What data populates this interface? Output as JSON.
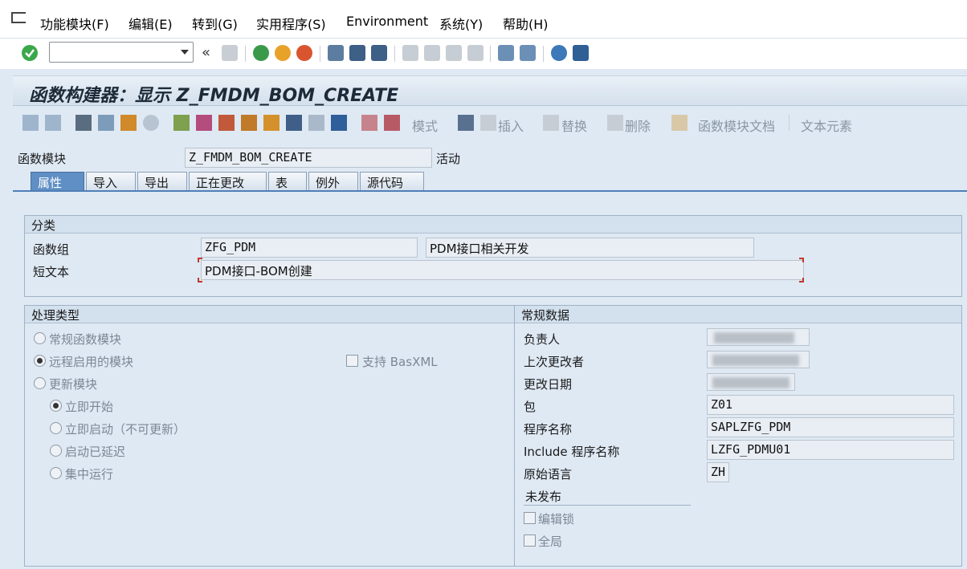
{
  "menu": {
    "items": [
      {
        "label": "功能模块(F)"
      },
      {
        "label": "编辑(E)"
      },
      {
        "label": "转到(G)"
      },
      {
        "label": "实用程序(S)"
      },
      {
        "label": "Environment"
      },
      {
        "label": "系统(Y)"
      },
      {
        "label": "帮助(H)"
      }
    ]
  },
  "toolbar": {
    "command_value": "",
    "back_chevrons": "«"
  },
  "title": "函数构建器：显示 Z_FMDM_BOM_CREATE",
  "app_toolbar": {
    "mode_label": "模式",
    "insert_label": "插入",
    "replace_label": "替换",
    "delete_label": "删除",
    "fm_doc_label": "函数模块文档",
    "text_elements_label": "文本元素"
  },
  "header": {
    "fm_label": "函数模块",
    "fm_value": "Z_FMDM_BOM_CREATE",
    "status": "活动"
  },
  "tabs": [
    {
      "label": "属性",
      "active": true
    },
    {
      "label": "导入"
    },
    {
      "label": "导出"
    },
    {
      "label": "正在更改"
    },
    {
      "label": "表"
    },
    {
      "label": "例外"
    },
    {
      "label": "源代码"
    }
  ],
  "classification": {
    "title": "分类",
    "group_label": "函数组",
    "group_value": "ZFG_PDM",
    "group_desc": "PDM接口相关开发",
    "short_text_label": "短文本",
    "short_text_value": "PDM接口-BOM创建"
  },
  "processing": {
    "title": "处理类型",
    "normal": "常规函数模块",
    "remote": "远程启用的模块",
    "basxml": "支持 BasXML",
    "update": "更新模块",
    "start_immediately": "立即开始",
    "start_immediately_no_update": "立即启动（不可更新）",
    "start_delayed": "启动已延迟",
    "collective_run": "集中运行"
  },
  "general": {
    "title": "常规数据",
    "responsible_label": "负责人",
    "last_changed_by_label": "上次更改者",
    "change_date_label": "更改日期",
    "package_label": "包",
    "package_value": "Z01",
    "program_label": "程序名称",
    "program_value": "SAPLZFG_PDM",
    "include_label": "Include 程序名称",
    "include_value": "LZFG_PDMU01",
    "language_label": "原始语言",
    "language_value": "ZH",
    "not_released": "未发布",
    "edit_lock": "编辑锁",
    "global": "全局"
  }
}
